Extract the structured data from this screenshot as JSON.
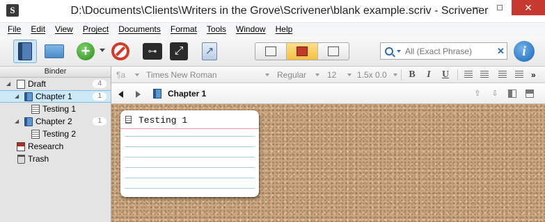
{
  "window": {
    "title": "D:\\Documents\\Clients\\Writers in the Grove\\Scrivener\\blank example.scriv - Scrivener",
    "minimize": "—",
    "maximize": "☐",
    "close": "✕"
  },
  "menu": [
    "File",
    "Edit",
    "View",
    "Project",
    "Documents",
    "Format",
    "Tools",
    "Window",
    "Help"
  ],
  "toolbar": {
    "search_placeholder": "All (Exact Phrase)",
    "search_clear": "✕",
    "info_label": "i",
    "add_label": "+",
    "key_label": "⊶",
    "fullscreen_label": "⤢",
    "compile_label": "↗"
  },
  "binder": {
    "header": "Binder",
    "items": [
      {
        "label": "Draft",
        "badge": "4",
        "level": 0,
        "expanded": true,
        "icon": "draft-icon"
      },
      {
        "label": "Chapter 1",
        "badge": "1",
        "level": 1,
        "expanded": true,
        "selected": true,
        "icon": "folder-icon"
      },
      {
        "label": "Testing 1",
        "badge": "",
        "level": 2,
        "icon": "document-icon"
      },
      {
        "label": "Chapter 2",
        "badge": "1",
        "level": 1,
        "expanded": true,
        "icon": "folder-icon"
      },
      {
        "label": "Testing 2",
        "badge": "",
        "level": 2,
        "icon": "document-icon"
      },
      {
        "label": "Research",
        "badge": "",
        "level": 0,
        "icon": "research-icon"
      },
      {
        "label": "Trash",
        "badge": "",
        "level": 0,
        "icon": "trash-icon"
      }
    ]
  },
  "format_bar": {
    "style": "¶a",
    "font": "Times New Roman",
    "weight": "Regular",
    "size": "12",
    "spacing": "1.5x 0.0",
    "bold": "B",
    "italic": "I",
    "underline": "U",
    "more": "»"
  },
  "editor": {
    "header_title": "Chapter 1"
  },
  "corkboard": {
    "cards": [
      {
        "title": "Testing 1"
      }
    ]
  }
}
